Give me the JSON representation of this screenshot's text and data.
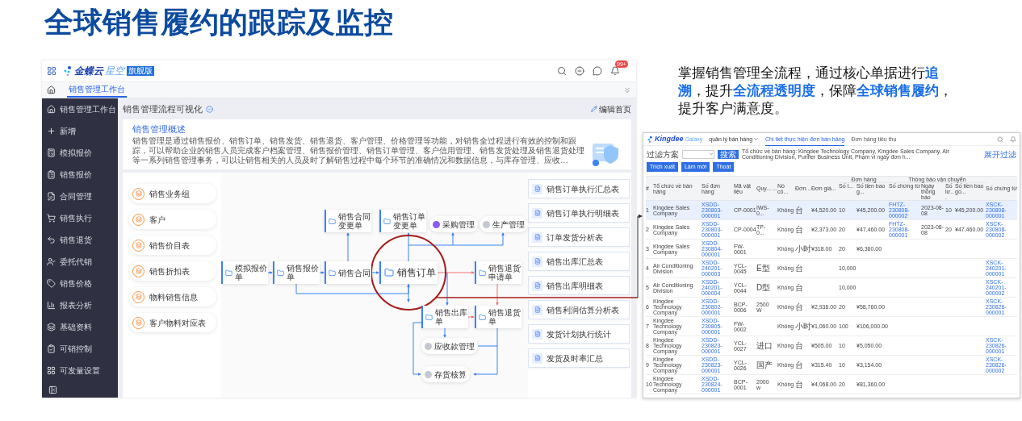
{
  "title": "全球销售履约的跟踪及监控",
  "app": {
    "brand": "金蝶云",
    "brand_sub": "星空",
    "edition": "旗舰版",
    "notification_badge": "99+",
    "tabs": [
      {
        "label": "销售管理工作台",
        "selected": true
      }
    ],
    "sidebar": {
      "items": [
        "销售管理工作台",
        "新增",
        "模拟报价",
        "销售报价",
        "合同管理",
        "销售执行",
        "销售退货",
        "委托代销",
        "销售价格",
        "报表分析",
        "基础资料",
        "可销控制",
        "可发量设置"
      ]
    },
    "page_title": "销售管理流程可视化",
    "edit_link": "编辑首页",
    "overview": {
      "title": "销售管理概述",
      "description": "销售管理是通过销售报价、销售订单、销售发货、销售退货、客户管理、价格管理等功能，对销售全过程进行有效的控制和跟踪，可以帮助企业的销售人员完成客户档案管理、销售报价管理、销售订单管理、客户信用管理、销售发货处理及销售退货处理等一系列销售管理事务，可以让销售相关的人员及时了解销售过程中每个环节的准确情况和数据信息，与库存管理、应收…"
    },
    "master_data": [
      "销售业务组",
      "客户",
      "销售价目表",
      "销售折扣表",
      "物料销售信息",
      "客户物料对应表"
    ],
    "flow": {
      "nodes": [
        {
          "label": "模拟报价单",
          "kind": "document"
        },
        {
          "label": "销售报价单",
          "kind": "document"
        },
        {
          "label": "销售合同",
          "kind": "document"
        },
        {
          "label": "销售订单",
          "kind": "main"
        },
        {
          "label": "销售退货申请单",
          "kind": "document"
        },
        {
          "label": "销售合同变更单",
          "kind": "document"
        },
        {
          "label": "销售订单变更单",
          "kind": "document"
        },
        {
          "label": "采购管理",
          "kind": "module",
          "color": "#8b5cf6"
        },
        {
          "label": "生产管理",
          "kind": "module",
          "color": "#c4c8d0"
        },
        {
          "label": "销售出库单",
          "kind": "document"
        },
        {
          "label": "销售退货单",
          "kind": "document"
        },
        {
          "label": "应收款管理",
          "kind": "module",
          "color": "#c4c8d0"
        },
        {
          "label": "存货核算",
          "kind": "module",
          "color": "#c4c8d0"
        }
      ]
    },
    "reports": [
      "销售订单执行汇总表",
      "销售订单执行明细表",
      "订单发货分析表",
      "销售出库汇总表",
      "销售出库明细表",
      "销售利润估算分析表",
      "发货计划执行统计",
      "发货及时率汇总"
    ]
  },
  "summary": "掌握销售管理全流程，通过核心单据进行**追溯**，提升**全流程透明度**，保障**全球销售履约**，提升客户满意度。",
  "embedded": {
    "logo": "Kingdee",
    "logo_sub": "Galaxy",
    "menu": "quản lý bán hàng",
    "tabs": [
      {
        "label": "Chi tiết thực hiện đơn bán hàng",
        "selected": true
      },
      {
        "label": "Đơn hàng tiêu thụ",
        "selected": false
      }
    ],
    "filter_label": "过滤方案",
    "search_button": "搜索",
    "filter_text": "Tổ chức về bán hàng: Kingdee Technology Company, Kingdee Sales Company, Air Conditioning Division, Purifier Business Unit, Phạm vi ngày đơn h...",
    "expand_link": "展开过滤",
    "buttons": [
      "Trích xuất",
      "Làm mới",
      "Thoát"
    ],
    "columns": [
      "#",
      "Tổ chức về bán hàng",
      "Số đơn hàng",
      "Mã vật liệu",
      "Quy...",
      "...",
      "Nó có...",
      "Đơn...",
      "Đơn giá..."
    ],
    "groups": [
      {
        "label": "Đơn hàng",
        "columns": [
          "Số l...",
          "Số tiền bao g..."
        ]
      },
      {
        "label": "Thông báo vận chuyển",
        "columns": [
          "Số chứng từ",
          "Ngày thông báo",
          "Số lư...",
          "Số tiền bao gồ..."
        ]
      }
    ],
    "last_column": "Số chứng từ",
    "rows": [
      {
        "selected": true,
        "cells": [
          "1",
          "Kingdee Sales Company",
          "XSDD-230803-000001",
          "CP-0001",
          "IWS-0...",
          null,
          "Không",
          "台",
          "¥4,520.00",
          "10",
          "¥45,200.00",
          "FHTZ-230808-000002",
          "2023-08-08",
          "10",
          "¥45,200.00",
          "XSCK-230808-000001"
        ]
      },
      {
        "selected": false,
        "cells": [
          "2",
          "Kingdee Sales Company",
          "XSDD-230803-000001",
          "CP-0004",
          "TP-0...",
          null,
          "Không",
          "台",
          "¥2,373.00",
          "20",
          "¥47,460.00",
          "FHTZ-230808-000001",
          "2023-08-08",
          "20",
          "¥47,460.00",
          "XSCK-230808-000002"
        ]
      },
      {
        "selected": false,
        "cells": [
          "3",
          "Kingdee Sales Company",
          "XSDD-230804-000001",
          "FW-0001",
          null,
          null,
          "Không",
          "小时",
          "¥318.00",
          "20",
          "¥6,360.00",
          null,
          null,
          null,
          null,
          null
        ]
      },
      {
        "selected": false,
        "cells": [
          "4",
          "Air Conditioning Division",
          "XSDD-240201-000003",
          "YCL-0045",
          "E型",
          null,
          "Không",
          "台",
          null,
          "10,000",
          null,
          null,
          null,
          null,
          null,
          "XSCK-240201-000001"
        ]
      },
      {
        "selected": false,
        "cells": [
          "5",
          "Air Conditioning Division",
          "XSDD-240201-000004",
          "YCL-0044",
          "D型",
          null,
          "Không",
          "台",
          null,
          "10,000",
          null,
          null,
          null,
          null,
          null,
          "XSCK-240201-000002"
        ]
      },
      {
        "selected": false,
        "cells": [
          "6",
          "Kingdee Technology Company",
          "XSDD-230802-000001",
          "BCP-0006",
          "2500W",
          null,
          "Không",
          "台",
          "¥2,938.00",
          "20",
          "¥58,760.00",
          null,
          null,
          null,
          null,
          "XSCK-230826-000001"
        ]
      },
      {
        "selected": false,
        "cells": [
          "7",
          "Kingdee Technology Company",
          "XSDD-230805-000001",
          "FW-0002",
          null,
          null,
          "Không",
          "小时",
          "¥1,060.00",
          "100",
          "¥106,000.00",
          null,
          null,
          null,
          null,
          null
        ]
      },
      {
        "selected": false,
        "cells": [
          "8",
          "Kingdee Technology Company",
          "XSDD-230823-000001",
          "YCL-0027",
          "进口",
          null,
          "Không",
          "台",
          "¥505.00",
          "10",
          "¥5,050.00",
          null,
          null,
          null,
          null,
          "XSCK-230826-000001"
        ]
      },
      {
        "selected": false,
        "cells": [
          "9",
          "Kingdee Technology Company",
          "XSDD-230823-000001",
          "YCL-0026",
          "国产",
          null,
          "Không",
          "台",
          "¥315.40",
          "10",
          "¥3,154.00",
          null,
          null,
          null,
          null,
          "XSCK-230826-000002"
        ]
      },
      {
        "selected": false,
        "cells": [
          "10",
          "Kingdee Technology Company",
          "XSDD-230824-000001",
          "BCP-0001",
          "2000w",
          null,
          "Không",
          "台",
          "¥4,068.00",
          "20",
          "¥81,360.00",
          null,
          null,
          null,
          null,
          null
        ]
      }
    ]
  }
}
